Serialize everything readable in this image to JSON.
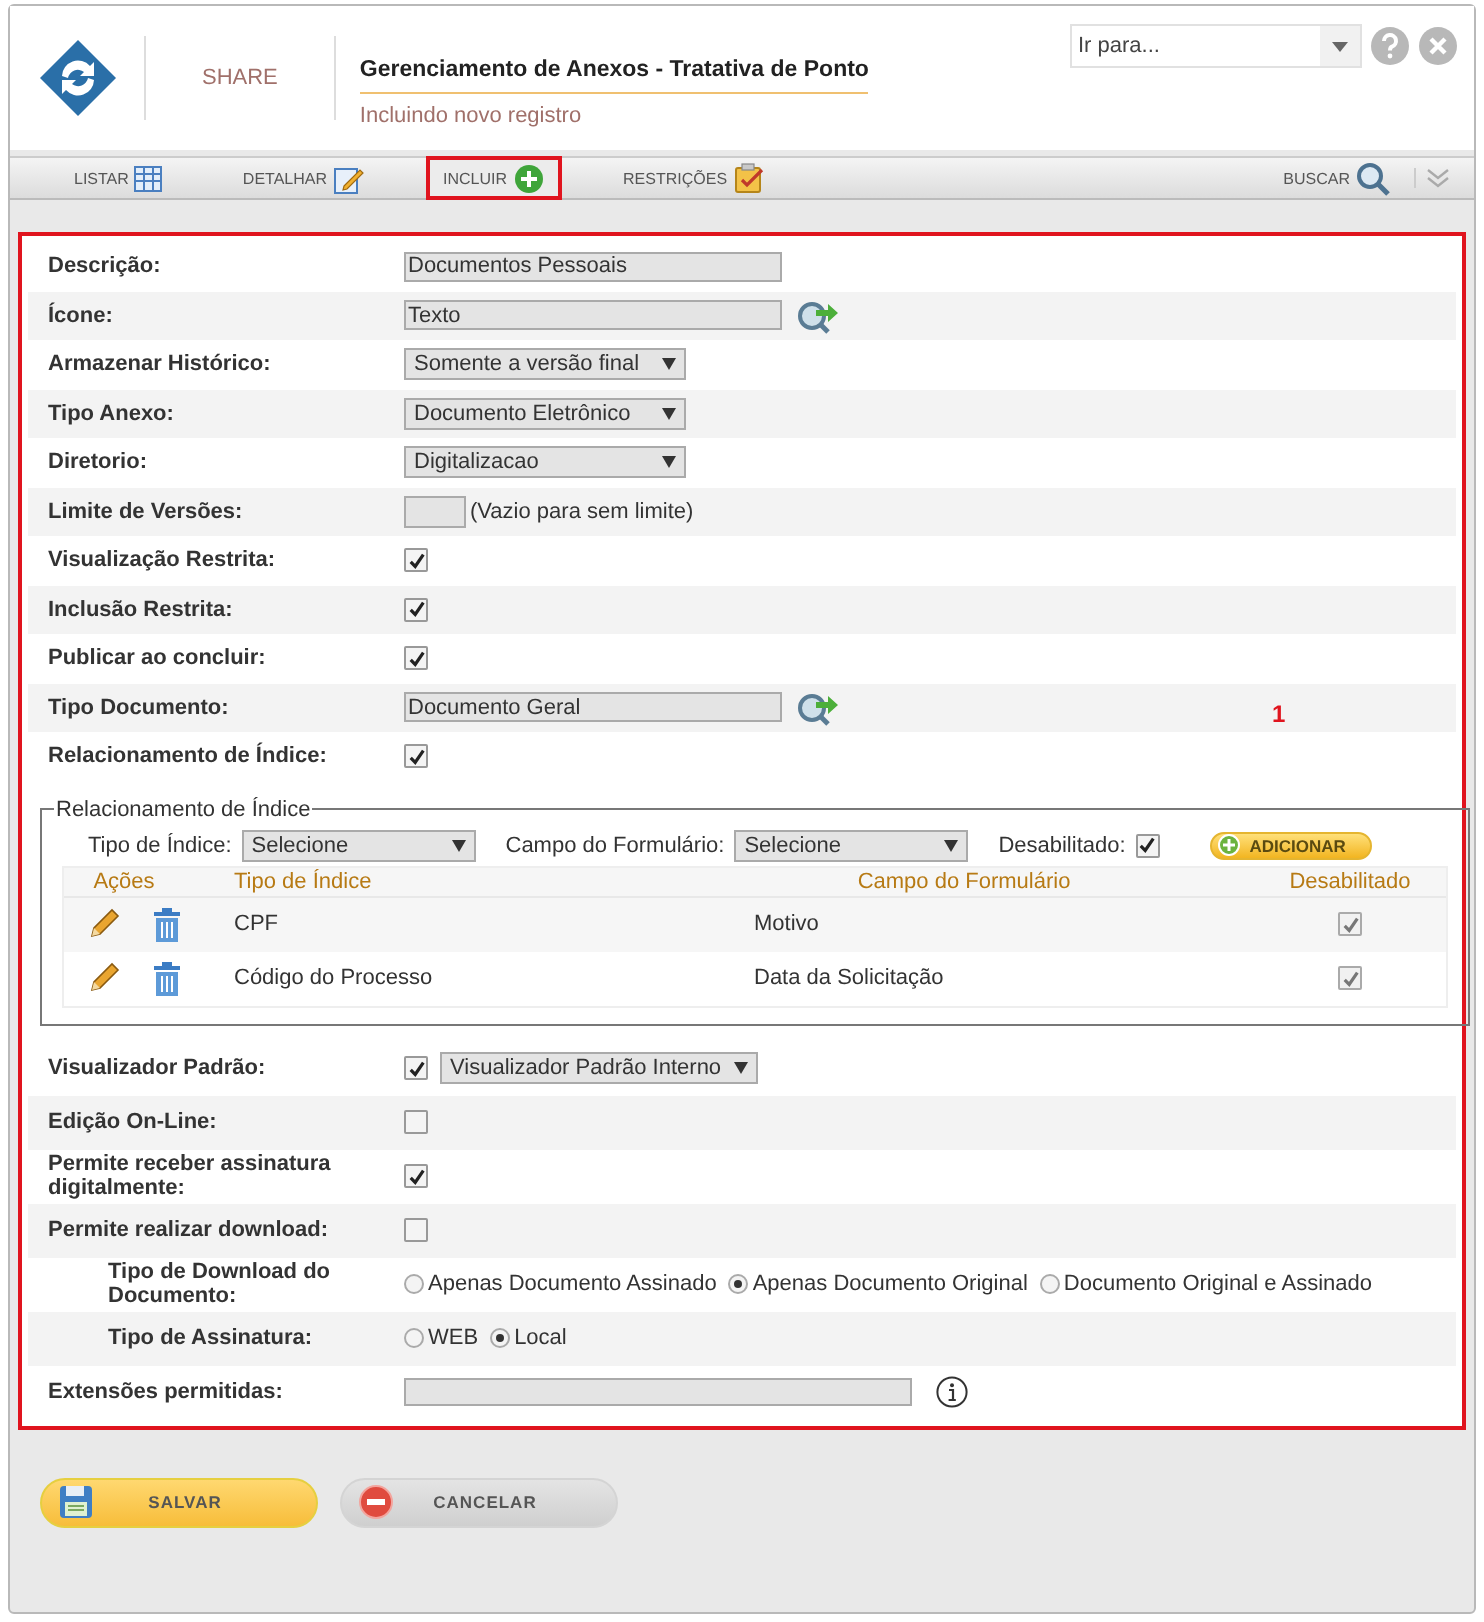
{
  "header": {
    "brand": "SHARE",
    "title": "Gerenciamento de Anexos - Tratativa de Ponto",
    "subtitle": "Incluindo novo registro",
    "goto": {
      "placeholder": "Ir para..."
    }
  },
  "tabs": [
    {
      "label": "LISTAR",
      "selected": false,
      "callout": false
    },
    {
      "label": "DETALHAR",
      "selected": false,
      "callout": false
    },
    {
      "label": "INCLUIR",
      "selected": true,
      "callout": true
    },
    {
      "label": "RESTRIÇÕES",
      "selected": false,
      "callout": false
    }
  ],
  "search": {
    "label": "BUSCAR"
  },
  "form": {
    "callout": "1",
    "rows": [
      {
        "kind": "text",
        "label": "Descrição:",
        "value": "Documentos Pessoais"
      },
      {
        "kind": "lookup",
        "label": "Ícone:",
        "value": "Texto"
      },
      {
        "kind": "select",
        "label": "Armazenar Histórico:",
        "value": "Somente a versão final"
      },
      {
        "kind": "select",
        "label": "Tipo Anexo:",
        "value": "Documento Eletrônico"
      },
      {
        "kind": "select",
        "label": "Diretorio:",
        "value": "Digitalizacao"
      },
      {
        "kind": "short",
        "label": "Limite de Versões:",
        "hint": "(Vazio para sem limite)"
      },
      {
        "kind": "checkbox",
        "label": "Visualização Restrita:",
        "checked": true
      },
      {
        "kind": "checkbox",
        "label": "Inclusão Restrita:",
        "checked": true
      },
      {
        "kind": "checkbox",
        "label": "Publicar ao concluir:",
        "checked": true
      },
      {
        "kind": "lookup",
        "label": "Tipo Documento:",
        "value": "Documento Geral"
      },
      {
        "kind": "checkbox",
        "label": "Relacionamento de Índice:",
        "checked": true
      },
      {
        "kind": "fieldset",
        "legend": "Relacionamento de Índice",
        "filters": [
          {
            "label": "Tipo de Índice:",
            "value": "Selecione"
          },
          {
            "label": "Campo do Formulário:",
            "value": "Selecione"
          }
        ],
        "disabled_filter": {
          "label": "Desabilitado:",
          "checked": true
        },
        "add_button": "ADICIONAR",
        "columns": [
          "Ações",
          "Tipo de Índice",
          "Campo do Formulário",
          "Desabilitado"
        ],
        "items": [
          {
            "index_type": "CPF",
            "form_field": "Motivo",
            "disabled": true
          },
          {
            "index_type": "Código do Processo",
            "form_field": "Data da Solicitação",
            "disabled": true
          }
        ]
      },
      {
        "kind": "checkbox_select",
        "label": "Visualizador Padrão:",
        "checked": true,
        "value": "Visualizador Padrão Interno"
      },
      {
        "kind": "checkbox",
        "label": "Edição On-Line:",
        "checked": false
      },
      {
        "kind": "checkbox",
        "label": "Permite receber assinatura digitalmente:",
        "checked": true
      },
      {
        "kind": "checkbox",
        "label": "Permite realizar download:",
        "checked": false,
        "children": [
          {
            "kind": "radio",
            "label": "Tipo de Download do Documento:",
            "options": [
              {
                "label": "Apenas Documento Assinado",
                "selected": false
              },
              {
                "label": "Apenas Documento Original",
                "selected": true
              },
              {
                "label": "Documento Original e Assinado",
                "selected": false
              }
            ]
          },
          {
            "kind": "radio",
            "label": "Tipo de Assinatura:",
            "options": [
              {
                "label": "WEB",
                "selected": false
              },
              {
                "label": "Local",
                "selected": true
              }
            ]
          }
        ]
      },
      {
        "kind": "info",
        "label": "Extensões permitidas:"
      }
    ]
  },
  "buttons": [
    {
      "kind": "save",
      "label": "SALVAR"
    },
    {
      "kind": "cancel",
      "label": "CANCELAR"
    }
  ]
}
